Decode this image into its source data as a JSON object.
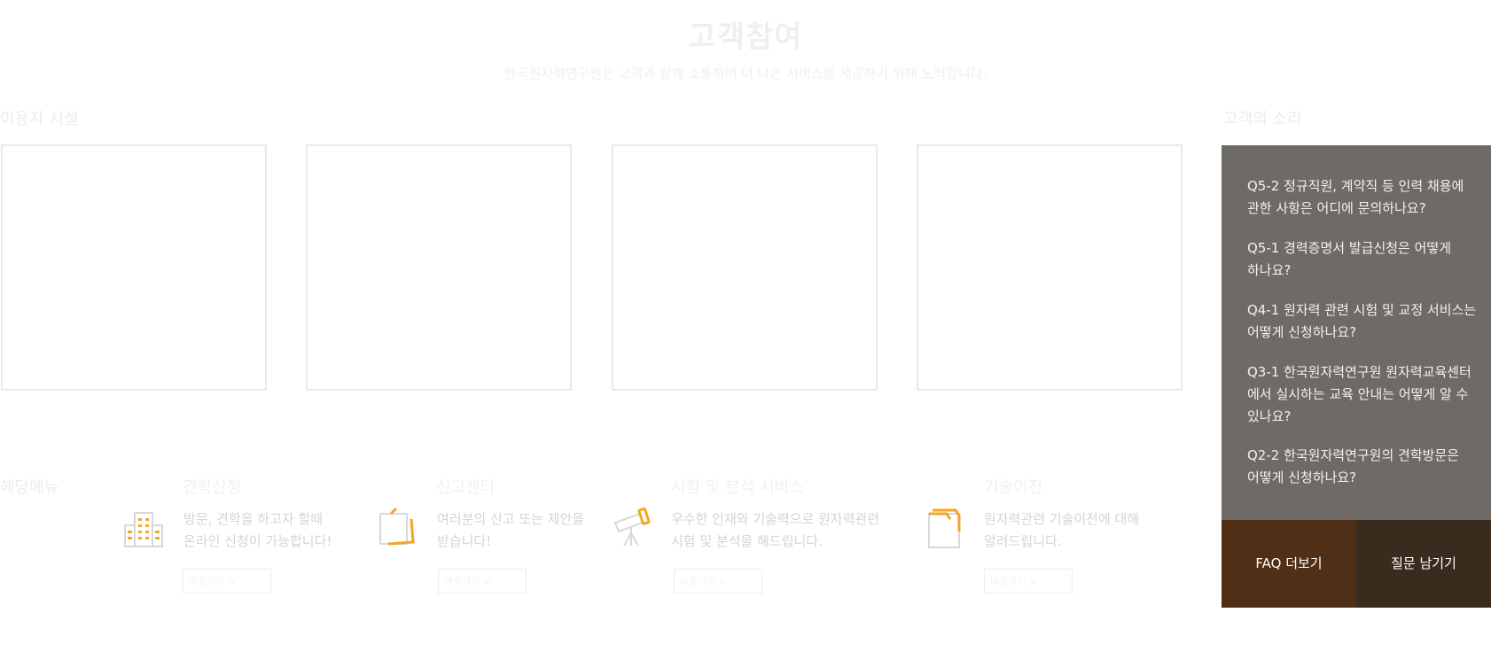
{
  "header": {
    "title": "고객참여",
    "subtitle": "한국원자력연구원은 고객과 함께 소통하며 더 나은 서비스를 제공하기 위해 노력합니다."
  },
  "sections": {
    "facilities_label": "이용자 시설",
    "faq_label": "고객의 소리",
    "services_label": "해당메뉴"
  },
  "services": [
    {
      "icon": "building-icon",
      "title": "견학신청",
      "desc_line1": "방문, 견학을 하고자 할때",
      "desc_line2": "온라인 신청이 가능합니다!",
      "button": "바로가기 >"
    },
    {
      "icon": "memo-icon",
      "title": "신고센터",
      "desc_line1": "여러분의 신고 또는 제안을",
      "desc_line2": "받습니다!",
      "button": "바로가기 >"
    },
    {
      "icon": "telescope-icon",
      "title": "시험 및 분석 서비스",
      "desc_line1": "우수한 인재와 기술력으로 원자력관련",
      "desc_line2": "시험 및 분석을 해드립니다.",
      "button": "바로가기 >"
    },
    {
      "icon": "folder-icon",
      "title": "기술이전",
      "desc_line1": "원자력관련 기술이전에 대해",
      "desc_line2": "알려드립니다.",
      "button": "바로가기 >"
    }
  ],
  "faq": {
    "items": [
      {
        "line1": "Q5-2 정규직원, 계약직 등 인력 채용에",
        "line2": "관한 사항은 어디에 문의하나요?"
      },
      {
        "line1": "Q5-1 경력증명서 발급신청은 어떻게",
        "line2": "하나요?"
      },
      {
        "line1": "Q4-1 원자력 관련 시험 및 교정 서비스는",
        "line2": "어떻게 신청하나요?"
      },
      {
        "line1": "Q3-1 한국원자력연구원 원자력교육센터",
        "line2": "에서 실시하는 교육 안내는 어떻게 알 수",
        "line3": "있나요?"
      },
      {
        "line1": "Q2-2 한국원자력연구원의 견학방문은",
        "line2": "어떻게 신청하나요?"
      }
    ],
    "more_label": "FAQ 더보기",
    "ask_label": "질문 남기기"
  },
  "colors": {
    "accent_orange": "#f5a623",
    "faq_panel": "#6e6a66",
    "faq_more": "#4f2f16",
    "faq_ask": "#3a2b1f"
  }
}
